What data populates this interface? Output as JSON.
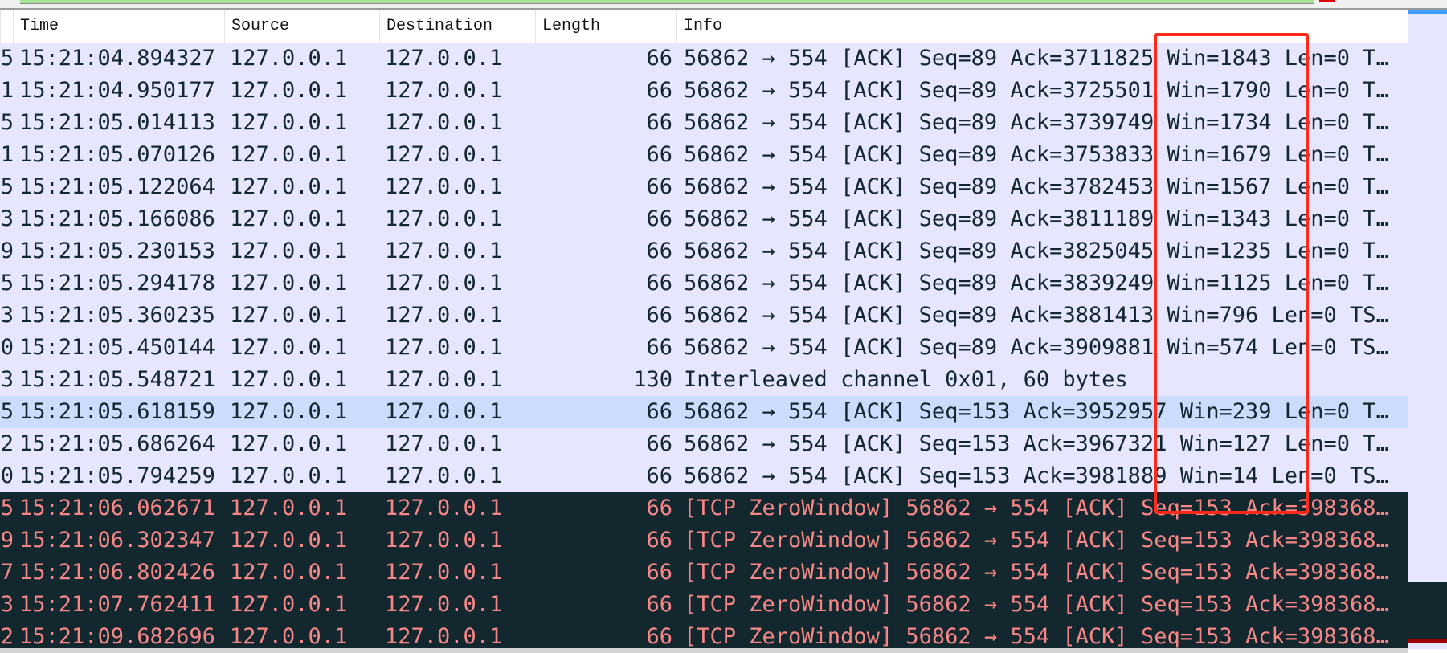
{
  "columns": {
    "time": "Time",
    "source": "Source",
    "destination": "Destination",
    "length": "Length",
    "info": "Info"
  },
  "colors": {
    "row_bg": "#e7e6ff",
    "selected_bg": "#cbdcfd",
    "zero_window_bg": "#12272e",
    "zero_window_fg": "#f78787",
    "annotation": "#ff2a1a"
  },
  "packets": [
    {
      "no": "5",
      "time": "15:21:04.894327",
      "src": "127.0.0.1",
      "dst": "127.0.0.1",
      "len": "66",
      "info": "56862 → 554 [ACK] Seq=89 Ack=3711825 Win=1843 Len=0 T…"
    },
    {
      "no": "1",
      "time": "15:21:04.950177",
      "src": "127.0.0.1",
      "dst": "127.0.0.1",
      "len": "66",
      "info": "56862 → 554 [ACK] Seq=89 Ack=3725501 Win=1790 Len=0 T…"
    },
    {
      "no": "5",
      "time": "15:21:05.014113",
      "src": "127.0.0.1",
      "dst": "127.0.0.1",
      "len": "66",
      "info": "56862 → 554 [ACK] Seq=89 Ack=3739749 Win=1734 Len=0 T…"
    },
    {
      "no": "1",
      "time": "15:21:05.070126",
      "src": "127.0.0.1",
      "dst": "127.0.0.1",
      "len": "66",
      "info": "56862 → 554 [ACK] Seq=89 Ack=3753833 Win=1679 Len=0 T…"
    },
    {
      "no": "5",
      "time": "15:21:05.122064",
      "src": "127.0.0.1",
      "dst": "127.0.0.1",
      "len": "66",
      "info": "56862 → 554 [ACK] Seq=89 Ack=3782453 Win=1567 Len=0 T…"
    },
    {
      "no": "3",
      "time": "15:21:05.166086",
      "src": "127.0.0.1",
      "dst": "127.0.0.1",
      "len": "66",
      "info": "56862 → 554 [ACK] Seq=89 Ack=3811189 Win=1343 Len=0 T…"
    },
    {
      "no": "9",
      "time": "15:21:05.230153",
      "src": "127.0.0.1",
      "dst": "127.0.0.1",
      "len": "66",
      "info": "56862 → 554 [ACK] Seq=89 Ack=3825045 Win=1235 Len=0 T…"
    },
    {
      "no": "5",
      "time": "15:21:05.294178",
      "src": "127.0.0.1",
      "dst": "127.0.0.1",
      "len": "66",
      "info": "56862 → 554 [ACK] Seq=89 Ack=3839249 Win=1125 Len=0 T…"
    },
    {
      "no": "3",
      "time": "15:21:05.360235",
      "src": "127.0.0.1",
      "dst": "127.0.0.1",
      "len": "66",
      "info": "56862 → 554 [ACK] Seq=89 Ack=3881413 Win=796 Len=0 TS…"
    },
    {
      "no": "0",
      "time": "15:21:05.450144",
      "src": "127.0.0.1",
      "dst": "127.0.0.1",
      "len": "66",
      "info": "56862 → 554 [ACK] Seq=89 Ack=3909881 Win=574 Len=0 TS…"
    },
    {
      "no": "3",
      "time": "15:21:05.548721",
      "src": "127.0.0.1",
      "dst": "127.0.0.1",
      "len": "130",
      "info": "Interleaved channel 0x01, 60 bytes"
    },
    {
      "no": "5",
      "time": "15:21:05.618159",
      "src": "127.0.0.1",
      "dst": "127.0.0.1",
      "len": "66",
      "info": "56862 → 554 [ACK] Seq=153 Ack=3952957 Win=239 Len=0 T…",
      "selected": true
    },
    {
      "no": "2",
      "time": "15:21:05.686264",
      "src": "127.0.0.1",
      "dst": "127.0.0.1",
      "len": "66",
      "info": "56862 → 554 [ACK] Seq=153 Ack=3967321 Win=127 Len=0 T…"
    },
    {
      "no": "0",
      "time": "15:21:05.794259",
      "src": "127.0.0.1",
      "dst": "127.0.0.1",
      "len": "66",
      "info": "56862 → 554 [ACK] Seq=153 Ack=3981889 Win=14 Len=0 TS…"
    },
    {
      "no": "5",
      "time": "15:21:06.062671",
      "src": "127.0.0.1",
      "dst": "127.0.0.1",
      "len": "66",
      "info": "[TCP ZeroWindow] 56862 → 554 [ACK] Seq=153 Ack=398368…",
      "zero": true
    },
    {
      "no": "9",
      "time": "15:21:06.302347",
      "src": "127.0.0.1",
      "dst": "127.0.0.1",
      "len": "66",
      "info": "[TCP ZeroWindow] 56862 → 554 [ACK] Seq=153 Ack=398368…",
      "zero": true
    },
    {
      "no": "7",
      "time": "15:21:06.802426",
      "src": "127.0.0.1",
      "dst": "127.0.0.1",
      "len": "66",
      "info": "[TCP ZeroWindow] 56862 → 554 [ACK] Seq=153 Ack=398368…",
      "zero": true
    },
    {
      "no": "3",
      "time": "15:21:07.762411",
      "src": "127.0.0.1",
      "dst": "127.0.0.1",
      "len": "66",
      "info": "[TCP ZeroWindow] 56862 → 554 [ACK] Seq=153 Ack=398368…",
      "zero": true
    },
    {
      "no": "2",
      "time": "15:21:09.682696",
      "src": "127.0.0.1",
      "dst": "127.0.0.1",
      "len": "66",
      "info": "[TCP ZeroWindow] 56862 → 554 [ACK] Seq=153 Ack=398368…",
      "zero": true
    }
  ]
}
